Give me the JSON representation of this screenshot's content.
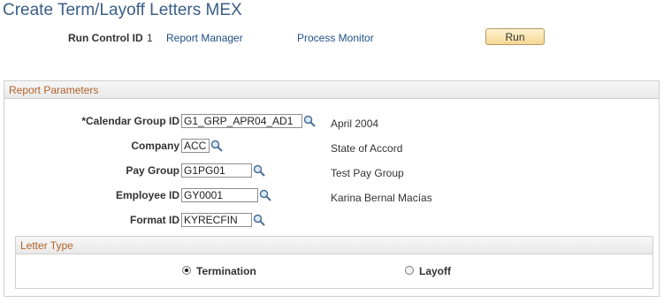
{
  "page": {
    "title": "Create Term/Layoff Letters MEX"
  },
  "run_control": {
    "label": "Run Control ID",
    "value": "1",
    "report_manager": "Report Manager",
    "process_monitor": "Process Monitor",
    "run_label": "Run"
  },
  "report_parameters": {
    "title": "Report Parameters",
    "fields": [
      {
        "label": "*Calendar Group ID",
        "value": "G1_GRP_APR04_AD1",
        "description": "April 2004",
        "icon": "lookup-icon"
      },
      {
        "label": "Company",
        "value": "ACC",
        "description": "State of Accord",
        "icon": "lookup-icon"
      },
      {
        "label": "Pay Group",
        "value": "G1PG01",
        "description": "Test Pay Group",
        "icon": "lookup-icon"
      },
      {
        "label": "Employee ID",
        "value": "GY0001",
        "description": "Karina Bernal Macías",
        "icon": "lookup-icon"
      },
      {
        "label": "Format ID",
        "value": "KYRECFIN",
        "description": "",
        "icon": "lookup-icon"
      }
    ]
  },
  "letter_type": {
    "title": "Letter Type",
    "options": [
      {
        "label": "Termination",
        "selected": true
      },
      {
        "label": "Layoff",
        "selected": false
      }
    ]
  },
  "colors": {
    "title": "#3a5e86",
    "link": "#1f4f86",
    "group_title": "#b2622a",
    "button_fill": "#f5d796"
  }
}
